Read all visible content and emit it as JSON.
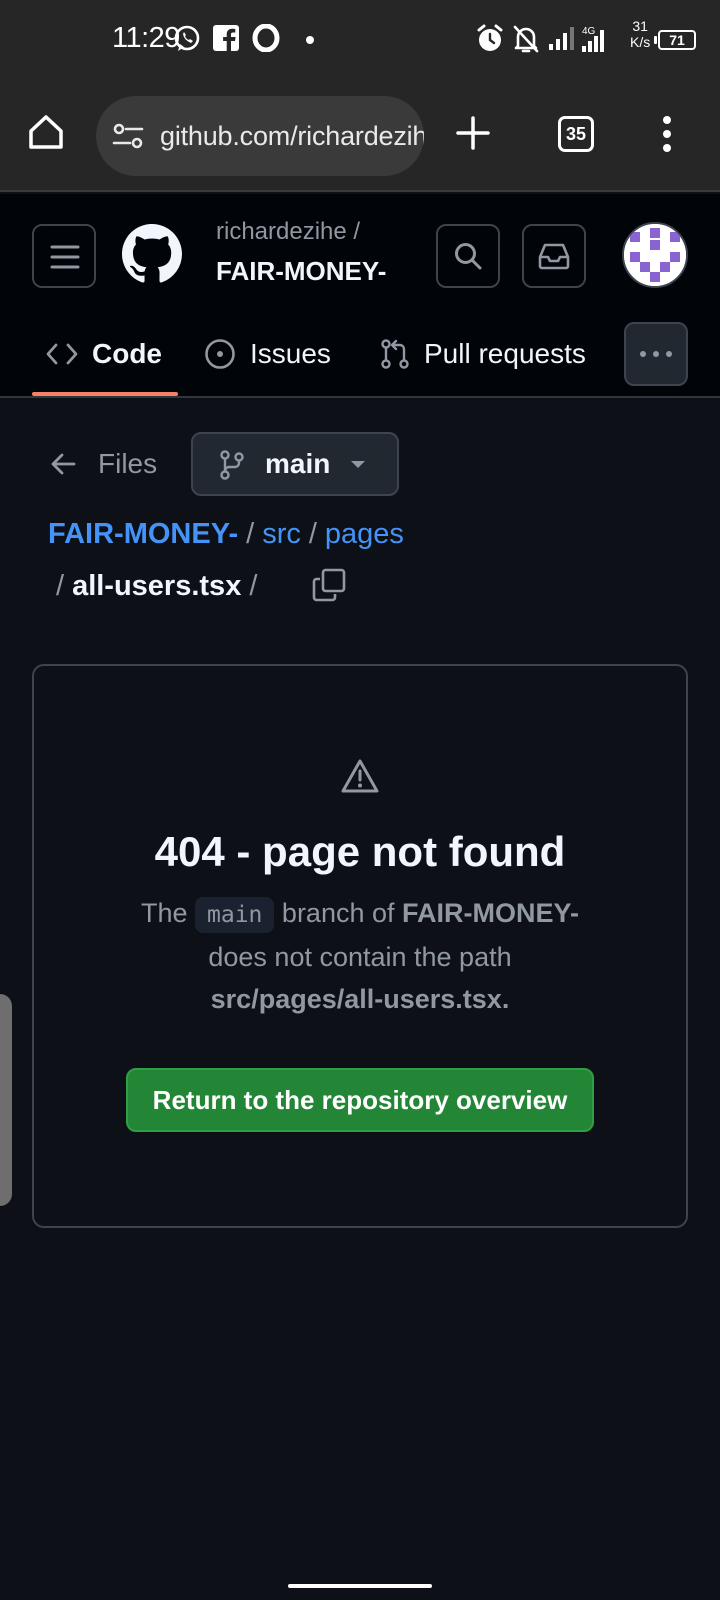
{
  "status_bar": {
    "time": "11:29",
    "network_type": "4G",
    "speed_value": "31",
    "speed_unit": "K/s",
    "battery": "71",
    "icons": [
      "whatsapp-icon",
      "facebook-icon",
      "opera-icon",
      "alarm-icon",
      "notifications-off-icon",
      "signal-icon"
    ]
  },
  "browser": {
    "url": "github.com/richardezihe",
    "tab_count": "35"
  },
  "github_header": {
    "repo_owner": "richardezihe /",
    "repo_name": "FAIR-MONEY-",
    "tabs": [
      {
        "label": "Code",
        "icon": "code-icon",
        "active": true
      },
      {
        "label": "Issues",
        "icon": "issue-opened-icon",
        "active": false
      },
      {
        "label": "Pull requests",
        "icon": "git-pull-request-icon",
        "active": false
      }
    ]
  },
  "nav": {
    "files_label": "Files",
    "branch": "main"
  },
  "breadcrumb": {
    "root": "FAIR-MONEY-",
    "dir1": "src",
    "dir2": "pages",
    "file": "all-users.tsx",
    "separator": "/"
  },
  "not_found": {
    "title": "404 - page not found",
    "text_the": "The",
    "branch_chip": "main",
    "text_branch_of": "branch of",
    "repo": "FAIR-MONEY-",
    "text_no_path": "does not contain the path",
    "path": "src/pages/all-users.tsx.",
    "button_label": "Return to the repository overview"
  },
  "colors": {
    "page_bg": "#0d1117",
    "header_bg": "#010409",
    "accent_link": "#4493f8",
    "tab_underline": "#f78166",
    "primary_button": "#238636"
  }
}
